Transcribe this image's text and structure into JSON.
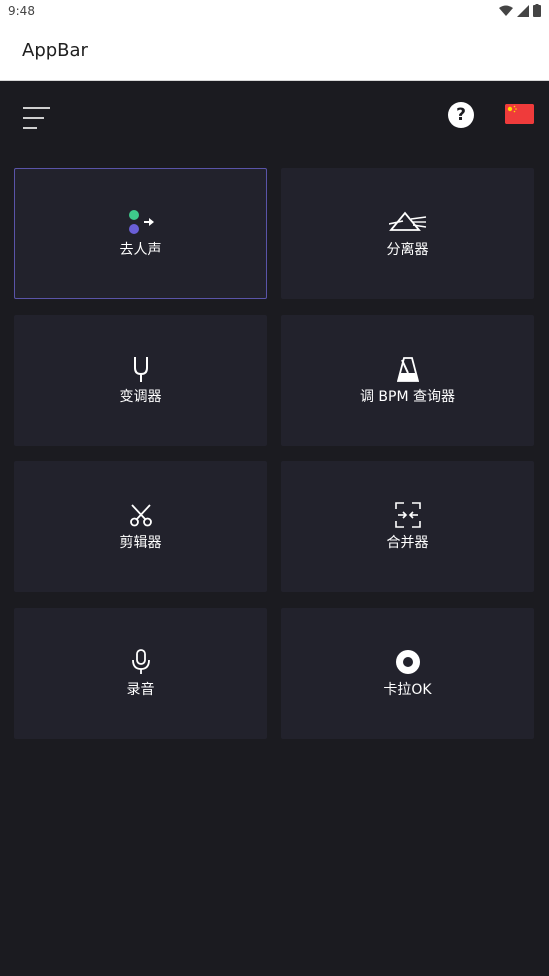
{
  "status": {
    "time": "9:48"
  },
  "appbar": {
    "title": "AppBar"
  },
  "toolbar": {
    "help_label": "?"
  },
  "tiles": [
    {
      "label": "去人声",
      "icon": "vocal-remove-icon"
    },
    {
      "label": "分离器",
      "icon": "prism-split-icon"
    },
    {
      "label": "变调器",
      "icon": "tuning-fork-icon"
    },
    {
      "label": "调 BPM 查询器",
      "icon": "metronome-icon"
    },
    {
      "label": "剪辑器",
      "icon": "scissors-icon"
    },
    {
      "label": "合并器",
      "icon": "merge-icon"
    },
    {
      "label": "录音",
      "icon": "microphone-icon"
    },
    {
      "label": "卡拉OK",
      "icon": "karaoke-disc-icon"
    }
  ],
  "colors": {
    "background": "#1b1b20",
    "tile": "#22222c",
    "selected_border": "#5a54a8",
    "green_dot": "#3ec98b",
    "purple_dot": "#6a5fd8",
    "flag_red": "#ef3b3b"
  }
}
